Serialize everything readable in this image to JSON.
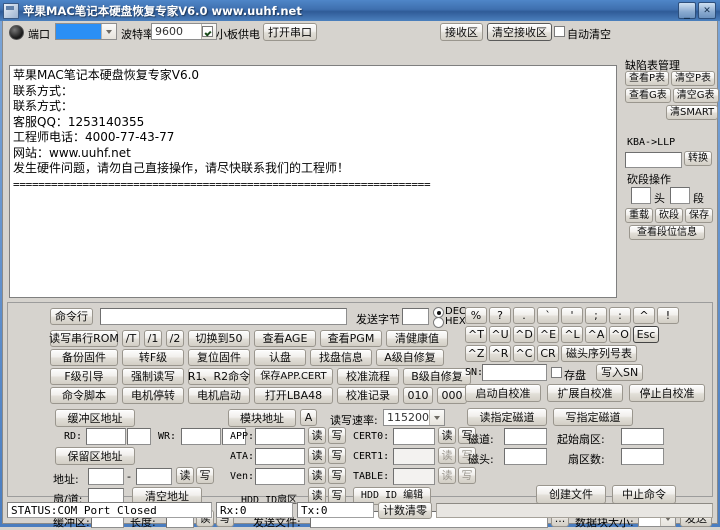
{
  "window": {
    "title": "苹果MAC笔记本硬盘恢复专家V6.0 www.uuhf.net",
    "minimize": "_",
    "close": "✕"
  },
  "toolbar": {
    "indicator": "power-indicator",
    "port_label": "端口",
    "port_value": "",
    "baud_label": "波特率",
    "baud_value": "9600",
    "power_check_label": "小板供电",
    "power_checked": true,
    "open_port": "打开串口",
    "recv_area": "接收区",
    "clear_recv": "清空接收区",
    "auto_clear_label": "自动清空",
    "auto_clear_checked": false
  },
  "receive": {
    "lines": [
      "苹果MAC笔记本硬盘恢复专家V6.0",
      "联系方式：",
      "联系方式：",
      "客服QQ：1253140355",
      "工程师电话：4000-77-43-77",
      "网站：www.uuhf.net",
      "发生硬件问题，请勿自己直接操作，请尽快联系我们的工程师！"
    ],
    "separator": "=================================================================="
  },
  "defect_panel": {
    "title": "缺陷表管理",
    "view_p": "查看P表",
    "clear_p": "清空P表",
    "view_g": "查看G表",
    "clear_g": "清空G表",
    "clear_smart": "清SMART",
    "kba_label": "KBA->LLP",
    "kba_value": "",
    "convert": "转换",
    "cut_title": "砍段操作",
    "head_label": "头",
    "head_value": "",
    "seg_label": "段",
    "seg_value": "",
    "reload": "重载",
    "cut": "砍段",
    "save": "保存",
    "view_seg_info": "查看段位信息"
  },
  "command": {
    "cmdline_label": "命令行",
    "cmdline_value": "",
    "send_byte_label": "发送字节",
    "send_byte_value": "",
    "dec_label": "DEC",
    "hex_label": "HEX",
    "radio_selected": "DEC"
  },
  "left_buttons": {
    "row1": [
      "读写串行ROM",
      "/T",
      "/1",
      "/2",
      "切换到50",
      "查看AGE",
      "查看PGM",
      "清健康值"
    ],
    "row2": [
      "备份固件",
      "转F级",
      "复位固件",
      "认盘",
      "找盘信息",
      "A级自修复"
    ],
    "row3": [
      "F级引导",
      "强制读写",
      "R1、R2命令",
      "保存APP.CERT",
      "校准流程",
      "B级自修复"
    ],
    "row4": [
      "命令脚本",
      "电机停转",
      "电机启动",
      "打开LBA48",
      "校准记录",
      "010",
      "000"
    ]
  },
  "hexkeys": {
    "row1": [
      "%",
      "?",
      ".",
      "`",
      "'",
      ";",
      ":",
      "^",
      "!"
    ],
    "row2": [
      "^T",
      "^U",
      "^D",
      "^E",
      "^L",
      "^A",
      "^O"
    ],
    "esc": "Esc",
    "row3": [
      "^Z",
      "^R",
      "^C",
      "CR"
    ],
    "head_serial_table": "磁头序列号表"
  },
  "sn": {
    "label": "SN:",
    "value": "",
    "save_disk_label": "存盘",
    "save_disk_checked": false,
    "write_sn": "写入SN"
  },
  "calibrate": {
    "start": "启动自校准",
    "extend": "扩展自校准",
    "stop": "停止自校准"
  },
  "buffer": {
    "title": "缓冲区地址",
    "rd_label": "RD:",
    "rd_value": "",
    "rd_value2": "",
    "wr_label": "WR:",
    "wr_value": "",
    "wr_value2": "",
    "reserved_title": "保留区地址",
    "addr_label": "地址:",
    "addr_from": "",
    "addr_dash": "-",
    "addr_to": "",
    "read": "读",
    "write": "写",
    "sector_track_label": "扇/道:",
    "sector_track_value": "",
    "clear_addr": "清空地址"
  },
  "module": {
    "title": "模块地址",
    "a_btn": "A",
    "speed_label": "读写速率:",
    "speed_value": "115200",
    "rows": [
      {
        "label": "APP:",
        "value": "",
        "read": "读",
        "write": "写",
        "disabled": false
      },
      {
        "label": "ATA:",
        "value": "",
        "read": "读",
        "write": "写",
        "disabled": false
      },
      {
        "label": "Ven:",
        "value": "",
        "read": "读",
        "write": "写",
        "disabled": false
      }
    ],
    "hdd_id_sector": "HDD ID扇区",
    "hdd_read": "读",
    "hdd_write": "写",
    "cert_rows": [
      {
        "label": "CERT0:",
        "value": "",
        "read": "读",
        "write": "写",
        "disabled": false
      },
      {
        "label": "CERT1:",
        "value": "",
        "read": "读",
        "write": "写",
        "disabled": true
      },
      {
        "label": "TABLE:",
        "value": "",
        "read": "读",
        "write": "写",
        "disabled": true
      }
    ],
    "hdd_id_edit": "HDD ID 编辑"
  },
  "track": {
    "read_spec": "读指定磁道",
    "write_spec": "写指定磁道",
    "track_label": "磁道:",
    "track_value": "",
    "start_sector_label": "起始扇区:",
    "start_sector_value": "",
    "head_label": "磁头:",
    "head_value": "",
    "sector_count_label": "扇区数:",
    "sector_count_value": "",
    "create_file": "创建文件",
    "abort_cmd": "中止命令"
  },
  "sendfile": {
    "buffer_label": "缓冲区:",
    "buffer_value": "",
    "length_label": "长度:",
    "length_value": "",
    "read": "读",
    "write": "写",
    "file_label": "发送文件:",
    "file_value": "",
    "browse": "...",
    "block_size_label": "数据块大小:",
    "block_size_value": "",
    "send": "发送"
  },
  "status": {
    "text": "STATUS:COM Port Closed",
    "rx": "Rx:0",
    "tx": "Tx:0",
    "clear_counter": "计数清零"
  }
}
